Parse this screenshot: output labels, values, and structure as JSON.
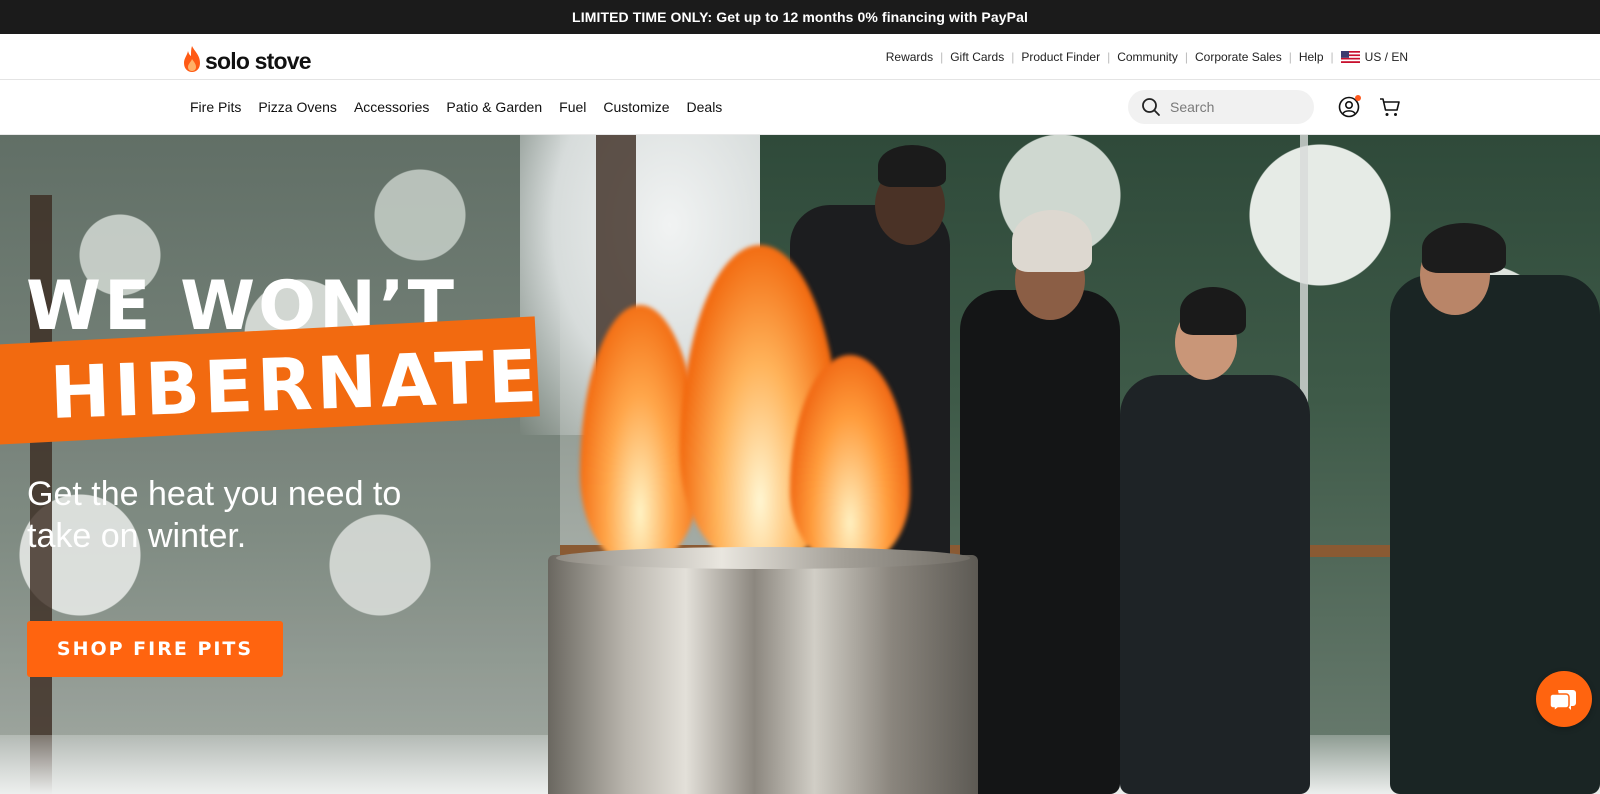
{
  "promo": {
    "text": "LIMITED TIME ONLY: Get up to 12 months 0% financing with PayPal"
  },
  "brand": {
    "name": "solo stove",
    "accent": "#ff640f"
  },
  "utility_links": [
    "Rewards",
    "Gift Cards",
    "Product Finder",
    "Community",
    "Corporate Sales",
    "Help"
  ],
  "locale": {
    "label": "US / EN",
    "flag_icon": "us-flag-icon"
  },
  "nav": {
    "items": [
      "Fire Pits",
      "Pizza Ovens",
      "Accessories",
      "Patio & Garden",
      "Fuel",
      "Customize",
      "Deals"
    ]
  },
  "search": {
    "placeholder": "Search",
    "icon": "search-icon"
  },
  "header_icons": {
    "account": "account-icon",
    "cart": "cart-icon"
  },
  "hero": {
    "headline_line1": "WE WON’T",
    "headline_line2": "HIBERNATE",
    "subhead": "Get the heat you need to take on winter.",
    "cta_label": "SHOP FIRE PITS",
    "banner_color": "#f26a10"
  },
  "chat": {
    "icon": "chat-icon"
  }
}
